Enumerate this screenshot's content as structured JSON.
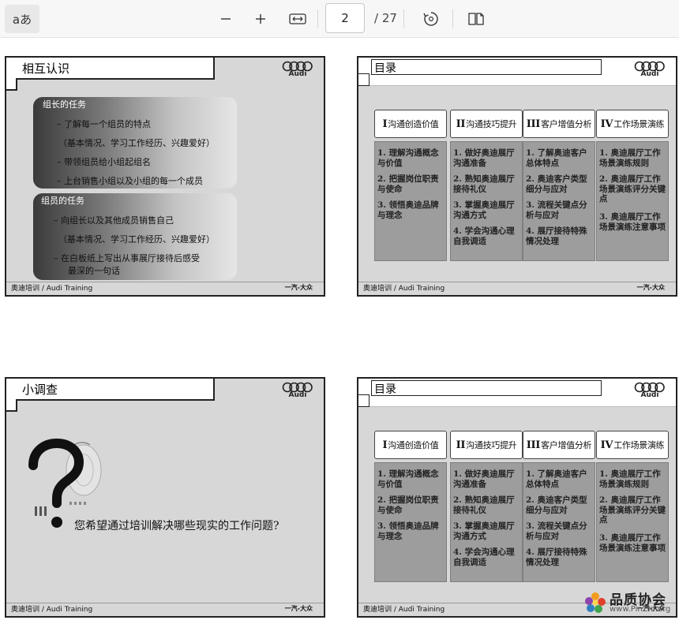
{
  "toolbar": {
    "read_aloud_label": "aあ",
    "current_page": "2",
    "total_pages": "/ 27"
  },
  "slides": [
    {
      "title": "相互认识",
      "leader_heading": "组长的任务",
      "leader_items": [
        "–   了解每一个组员的特点",
        "（基本情况、学习工作经历、兴趣爱好）",
        "–   带领组员给小组起组名",
        "–   上台销售小组以及小组的每一个成员"
      ],
      "member_heading": "组员的任务",
      "member_items": [
        "–   向组长以及其他成员销售自己",
        "（基本情况、学习工作经历、兴趣爱好）",
        "–   在白板纸上写出从事展厅接待后感受",
        "最深的一句话"
      ],
      "footer_left": "奥迪培训 / Audi Training",
      "footer_right": "一汽-大众",
      "logo_text": "Audi"
    },
    {
      "title": "目录",
      "columns": [
        {
          "roman": "I",
          "heading": "沟通创造价值",
          "items": [
            "1. 理解沟通概念与价值",
            "2. 把握岗位职责与使命",
            "3. 领悟奥迪品牌与理念"
          ]
        },
        {
          "roman": "II",
          "heading": "沟通技巧提升",
          "items": [
            "1. 做好奥迪展厅沟通准备",
            "2. 熟知奥迪展厅接待礼仪",
            "3. 掌握奥迪展厅沟通方式",
            "4. 学会沟通心理自我调适"
          ]
        },
        {
          "roman": "III",
          "heading": "客户增值分析",
          "items": [
            "1. 了解奥迪客户总体特点",
            "2. 奥迪客户类型细分与应对",
            "3. 流程关键点分析与应对",
            "4. 展厅接待特殊情况处理"
          ]
        },
        {
          "roman": "IV",
          "heading": "工作场景演练",
          "items": [
            "1. 奥迪展厅工作场景演练规则",
            "2. 奥迪展厅工作场景演练评分关键点",
            "3. 奥迪展厅工作场景演练注意事项"
          ]
        }
      ],
      "footer_left": "奥迪培训 / Audi Training",
      "footer_right": "一汽-大众",
      "logo_text": "Audi"
    },
    {
      "title": "小调查",
      "question": "您希望通过培训解决哪些现实的工作问题?",
      "footer_left": "奥迪培训 / Audi Training",
      "footer_right": "一汽-大众",
      "logo_text": "Audi"
    },
    {
      "title": "目录",
      "columns": [
        {
          "roman": "I",
          "heading": "沟通创造价值",
          "items": [
            "1. 理解沟通概念与价值",
            "2. 把握岗位职责与使命",
            "3. 领悟奥迪品牌与理念"
          ]
        },
        {
          "roman": "II",
          "heading": "沟通技巧提升",
          "items": [
            "1. 做好奥迪展厅沟通准备",
            "2. 熟知奥迪展厅接待礼仪",
            "3. 掌握奥迪展厅沟通方式",
            "4. 学会沟通心理自我调适"
          ]
        },
        {
          "roman": "III",
          "heading": "客户增值分析",
          "items": [
            "1. 了解奥迪客户总体特点",
            "2. 奥迪客户类型细分与应对",
            "3. 流程关键点分析与应对",
            "4. 展厅接待特殊情况处理"
          ]
        },
        {
          "roman": "IV",
          "heading": "工作场景演练",
          "items": [
            "1. 奥迪展厅工作场景演练规则",
            "2. 奥迪展厅工作场景演练评分关键点",
            "3. 奥迪展厅工作场景演练注意事项"
          ]
        }
      ],
      "footer_left": "奥迪培训 / Audi Training",
      "footer_right": "一汽-大众",
      "logo_text": "Audi"
    }
  ],
  "watermark": {
    "title": "品质协会",
    "url": "www.PinZhi.org"
  }
}
